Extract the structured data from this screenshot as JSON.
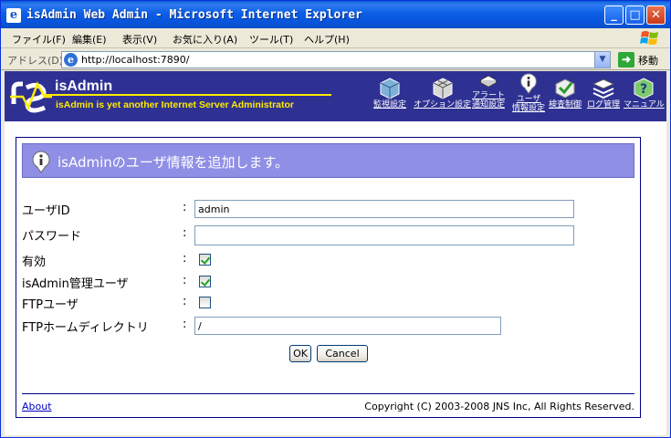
{
  "window": {
    "title": "isAdmin Web Admin - Microsoft Internet Explorer",
    "minimize_glyph": "_",
    "maximize_glyph": "□",
    "close_glyph": "✕"
  },
  "menubar": {
    "items": [
      "ファイル(F)",
      "編集(E)",
      "表示(V)",
      "お気に入り(A)",
      "ツール(T)",
      "ヘルプ(H)"
    ]
  },
  "addressbar": {
    "label": "アドレス(D)",
    "url": "http://localhost:7890/",
    "go_label": "移動"
  },
  "app": {
    "name": "isAdmin",
    "tagline": "isAdmin is yet another Internet Server Administrator",
    "nav": [
      {
        "label": "監視設定",
        "icon": "cube-icon"
      },
      {
        "label": "オプション設定",
        "icon": "gears-cube-icon"
      },
      {
        "label": "アラート\n通知設定",
        "icon": "envelope-icon"
      },
      {
        "label": "ユーザ\n情報設定",
        "icon": "info-icon"
      },
      {
        "label": "検査制御",
        "icon": "check-icon"
      },
      {
        "label": "ログ管理",
        "icon": "stack-icon"
      },
      {
        "label": "マニュアル",
        "icon": "help-icon"
      }
    ]
  },
  "form": {
    "heading": "isAdminのユーザ情報を追加します。",
    "colon": ":",
    "fields": {
      "user_id": {
        "label": "ユーザID",
        "value": "admin"
      },
      "password": {
        "label": "パスワード",
        "value": ""
      },
      "enabled": {
        "label": "有効",
        "checked": true
      },
      "admin_user": {
        "label": "isAdmin管理ユーザ",
        "checked": true
      },
      "ftp_user": {
        "label": "FTPユーザ",
        "checked": false
      },
      "ftp_home": {
        "label": "FTPホームディレクトリ",
        "value": "/"
      }
    },
    "ok_label": "OK",
    "cancel_label": "Cancel"
  },
  "footer": {
    "about": "About",
    "copyright": "Copyright (C) 2003-2008 JNS Inc, All Rights Reserved."
  },
  "colors": {
    "header_bg": "#2e3192",
    "accent_yellow": "#ffea00",
    "panel_head_bg": "#8f8fe6"
  }
}
